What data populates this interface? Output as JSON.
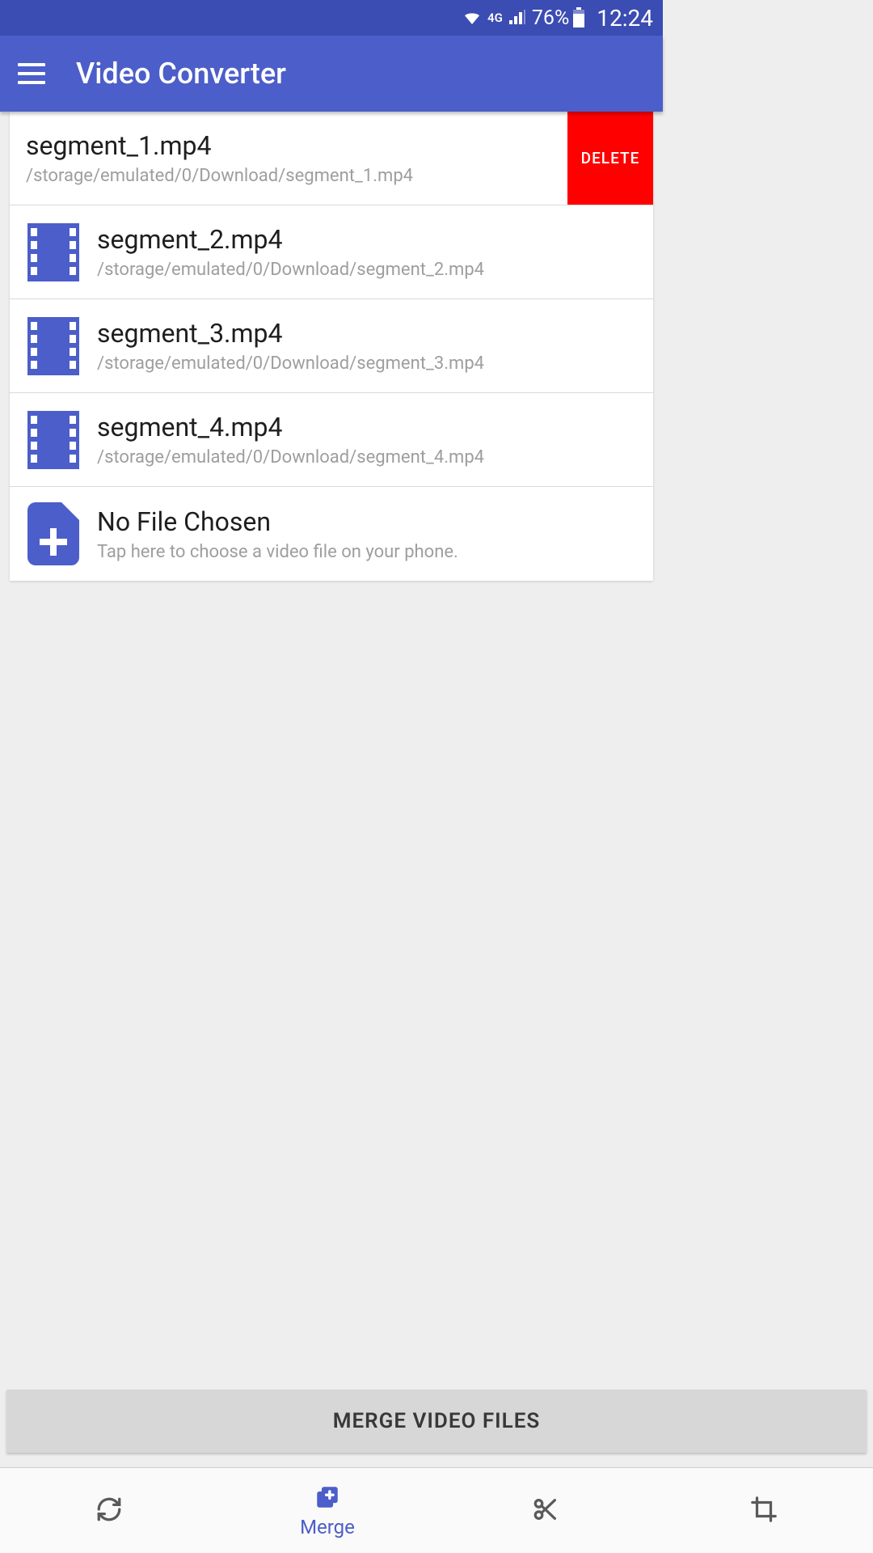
{
  "status": {
    "network": "4G",
    "battery": "76%",
    "time": "12:24"
  },
  "appbar": {
    "title": "Video Converter"
  },
  "files": [
    {
      "name": "segment_1.mp4",
      "path": "/storage/emulated/0/Download/segment_1.mp4",
      "swiped": true
    },
    {
      "name": "segment_2.mp4",
      "path": "/storage/emulated/0/Download/segment_2.mp4",
      "swiped": false
    },
    {
      "name": "segment_3.mp4",
      "path": "/storage/emulated/0/Download/segment_3.mp4",
      "swiped": false
    },
    {
      "name": "segment_4.mp4",
      "path": "/storage/emulated/0/Download/segment_4.mp4",
      "swiped": false
    }
  ],
  "chooser": {
    "title": "No File Chosen",
    "subtitle": "Tap here to choose a video file on your phone."
  },
  "delete_label": "DELETE",
  "merge_button": "MERGE VIDEO FILES",
  "bottom_nav": {
    "merge_label": "Merge"
  }
}
